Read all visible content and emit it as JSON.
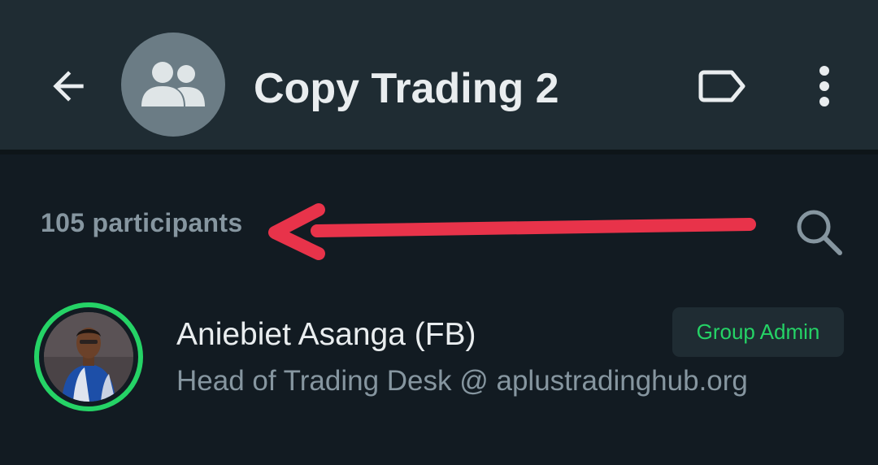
{
  "header": {
    "title": "Copy Trading 2",
    "back_icon": "arrow-left-icon",
    "group_avatar_icon": "group-icon",
    "label_icon": "label-tag-icon",
    "menu_icon": "more-vert-icon"
  },
  "participants": {
    "count_text": "105 participants",
    "search_icon": "search-icon",
    "annotation": "red-arrow-pointing-left",
    "members": [
      {
        "name": "Aniebiet Asanga (FB)",
        "about": "Head of Trading Desk @ aplustradinghub.org",
        "badge": "Group Admin"
      }
    ]
  },
  "colors": {
    "header_bg": "#1f2c33",
    "body_bg": "#121b22",
    "accent_green": "#25d366",
    "annotation_red": "#e8334a",
    "muted_text": "#8696a0"
  }
}
